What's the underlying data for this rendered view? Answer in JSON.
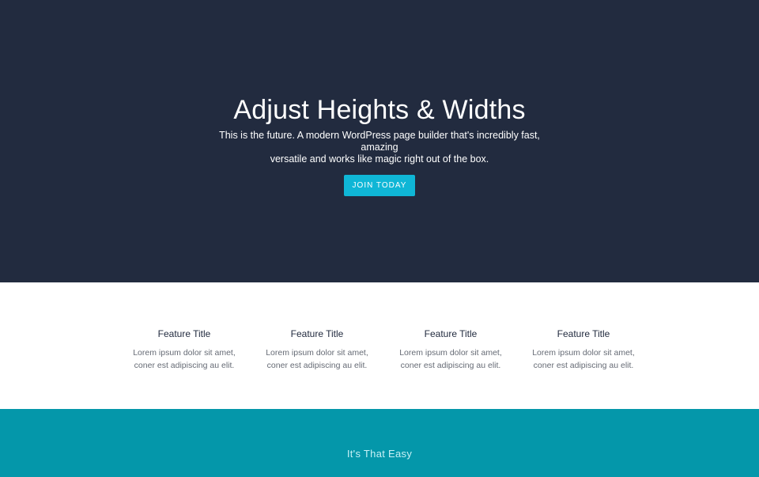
{
  "hero": {
    "title": "Adjust Heights & Widths",
    "subtitle_line1": "This is the future. A modern WordPress page builder that's incredibly fast, amazing",
    "subtitle_line2": "versatile and works like magic right out of the box.",
    "button_label": "JOIN TODAY",
    "background_color": "#222b3f",
    "button_color": "#0fb6d6"
  },
  "features": [
    {
      "title": "Feature Title",
      "text_line1": "Lorem ipsum dolor sit amet,",
      "text_line2": "coner est adipiscing au elit."
    },
    {
      "title": "Feature Title",
      "text_line1": "Lorem ipsum dolor sit amet,",
      "text_line2": "coner est adipiscing au elit."
    },
    {
      "title": "Feature Title",
      "text_line1": "Lorem ipsum dolor sit amet,",
      "text_line2": "coner est adipiscing au elit."
    },
    {
      "title": "Feature Title",
      "text_line1": "Lorem ipsum dolor sit amet,",
      "text_line2": "coner est adipiscing au elit."
    }
  ],
  "cta": {
    "text": "It's That Easy",
    "background_color": "#0497aa"
  }
}
